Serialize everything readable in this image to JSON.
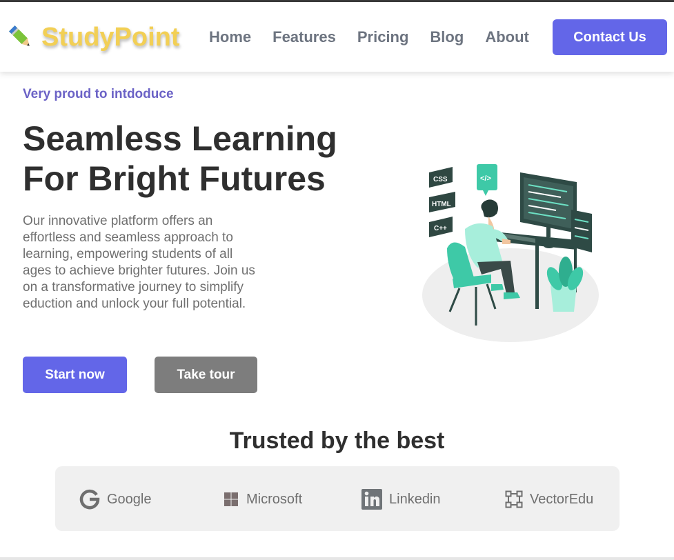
{
  "brand": {
    "name": "StudyPoint",
    "icon": "pencil-icon",
    "color": "#f2cf55"
  },
  "nav": {
    "links": [
      "Home",
      "Features",
      "Pricing",
      "Blog",
      "About"
    ],
    "contact_label": "Contact Us"
  },
  "hero": {
    "eyebrow": "Very proud to intdoduce",
    "headline_line1": "Seamless Learning",
    "headline_line2": "For Bright Futures",
    "description": "Our innovative platform offers an effortless and seamless approach to learning, empowering students of all ages to achieve brighter futures. Join us on a transformative journey to simplify eduction and unlock your full potential.",
    "start_label": "Start now",
    "tour_label": "Take tour",
    "illustration_tags": [
      "CSS",
      "HTML",
      "C++"
    ],
    "illustration_bubble": "</>"
  },
  "trusted": {
    "title": "Trusted by the best",
    "partners": [
      {
        "name": "Google",
        "icon": "google-icon"
      },
      {
        "name": "Microsoft",
        "icon": "microsoft-icon"
      },
      {
        "name": "Linkedin",
        "icon": "linkedin-icon"
      },
      {
        "name": "VectorEdu",
        "icon": "vector-icon"
      }
    ]
  },
  "colors": {
    "accent": "#6366e8",
    "eyebrow": "#6b62c6",
    "secondary_button": "#7d7d7d",
    "illustration_green": "#3ec9a7",
    "illustration_dark": "#2e4a45"
  }
}
